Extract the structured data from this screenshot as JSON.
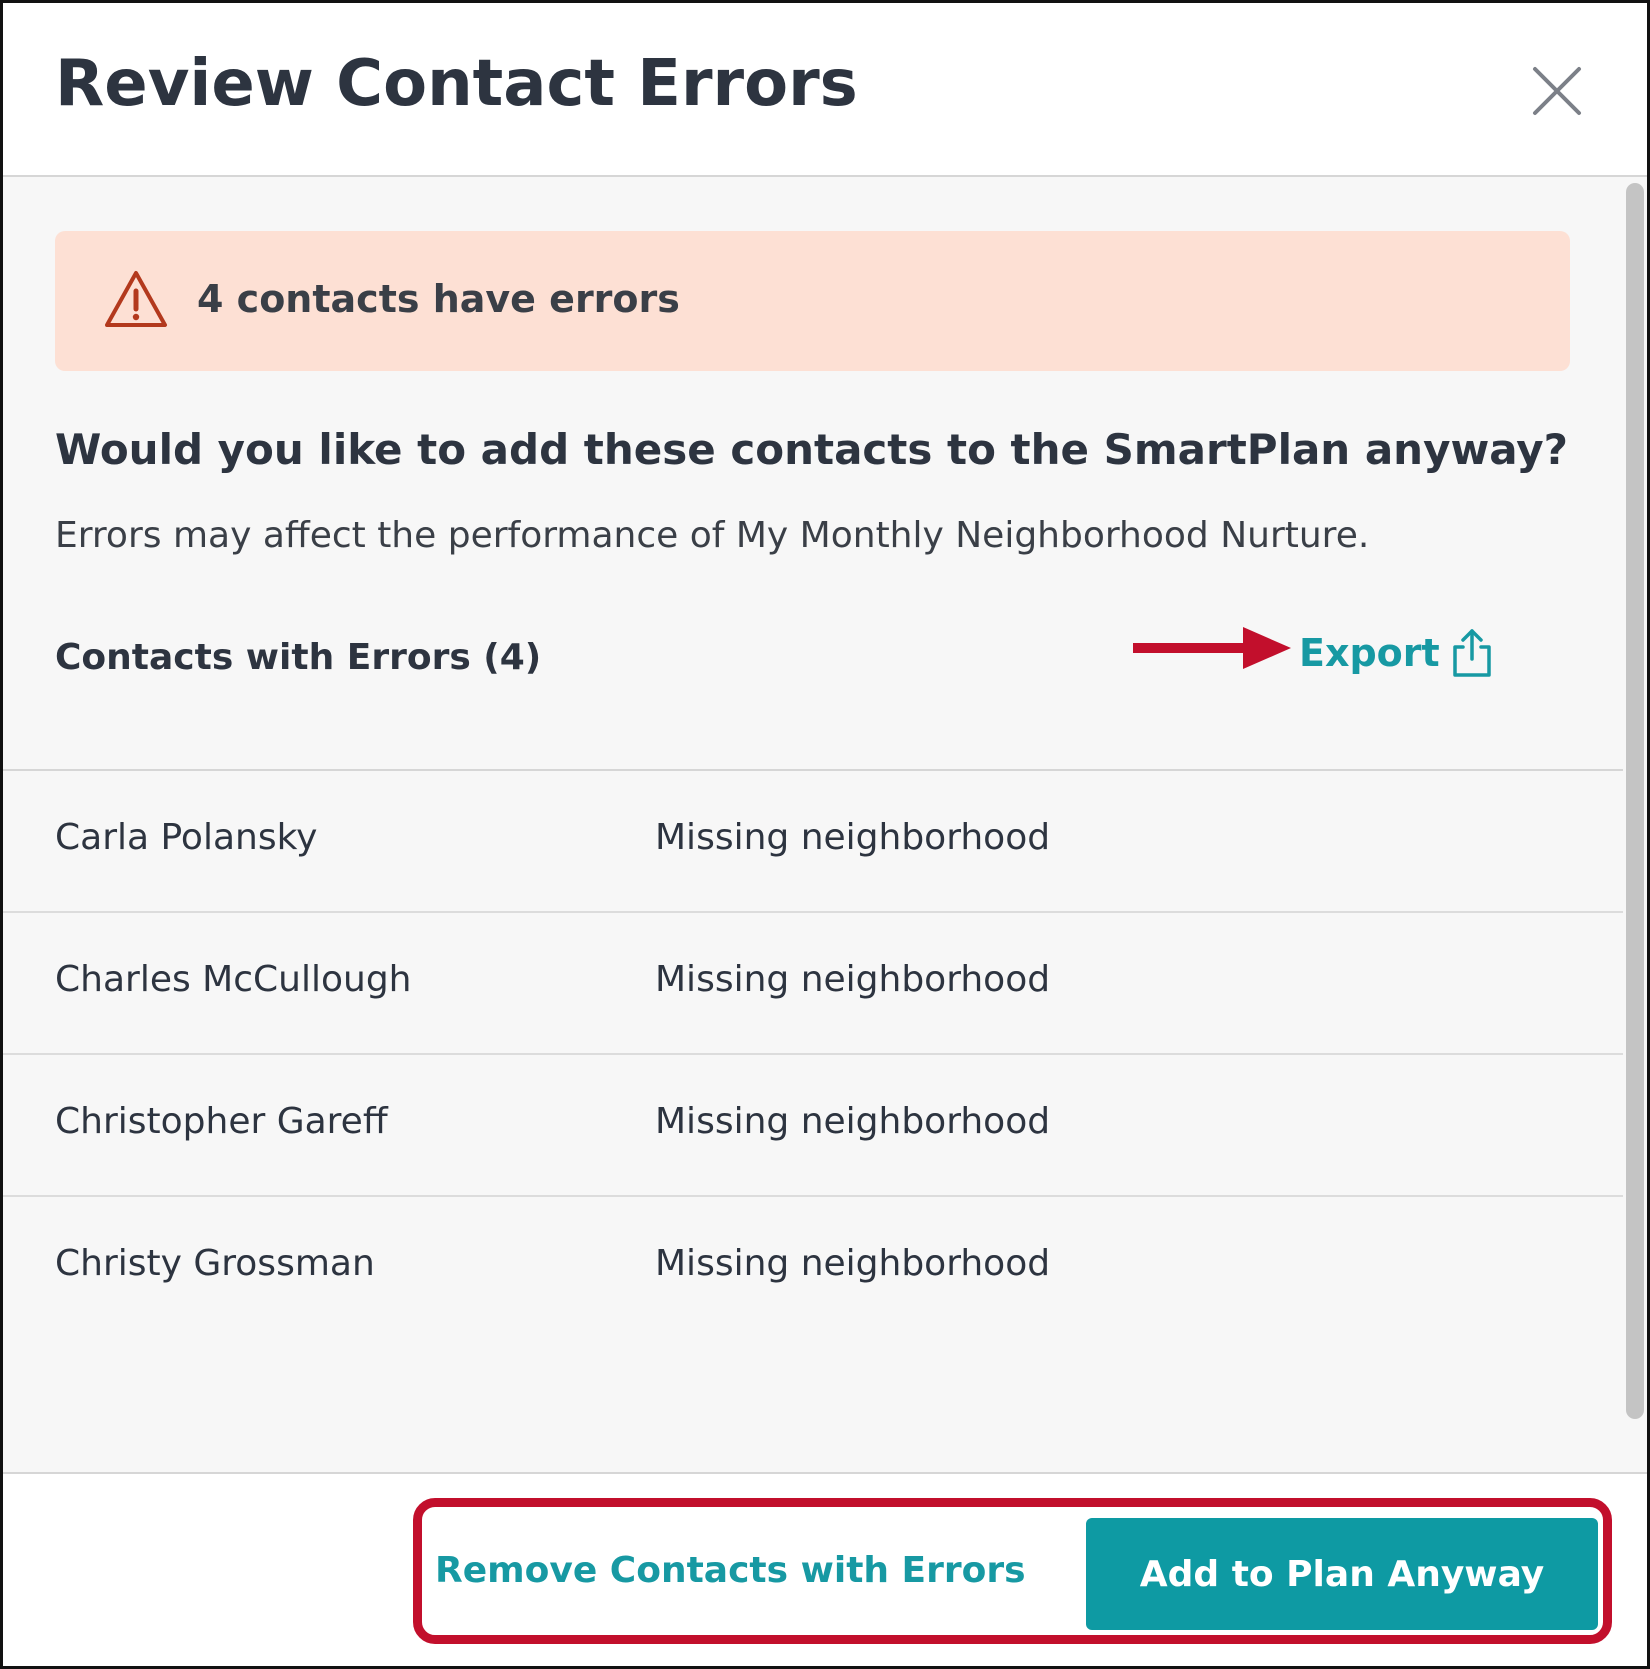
{
  "dialog": {
    "title": "Review Contact Errors",
    "close_icon": "close-icon"
  },
  "alert": {
    "icon": "warning-triangle-icon",
    "text": "4 contacts have errors",
    "background_color": "#fde0d4",
    "icon_color": "#b3391d"
  },
  "prompt": {
    "question": "Would you like to add these contacts to the SmartPlan anyway?",
    "description": "Errors may affect the performance of My Monthly Neighborhood Nurture."
  },
  "contacts_list": {
    "heading": "Contacts with Errors (4)",
    "export_label": "Export",
    "export_icon": "share-export-icon",
    "rows": [
      {
        "name": "Carla Polansky",
        "error": "Missing neighborhood"
      },
      {
        "name": "Charles McCullough",
        "error": "Missing neighborhood"
      },
      {
        "name": "Christopher Gareff",
        "error": "Missing neighborhood"
      },
      {
        "name": "Christy Grossman",
        "error": "Missing neighborhood"
      }
    ]
  },
  "footer": {
    "remove_label": "Remove Contacts with Errors",
    "add_label": "Add to Plan Anyway"
  },
  "annotations": {
    "arrow_icon": "red-arrow-icon",
    "highlight_color": "#c20f2c"
  },
  "colors": {
    "accent": "#1799a3",
    "primary_button": "#0e9aa3",
    "text_dark": "#2d3440"
  }
}
